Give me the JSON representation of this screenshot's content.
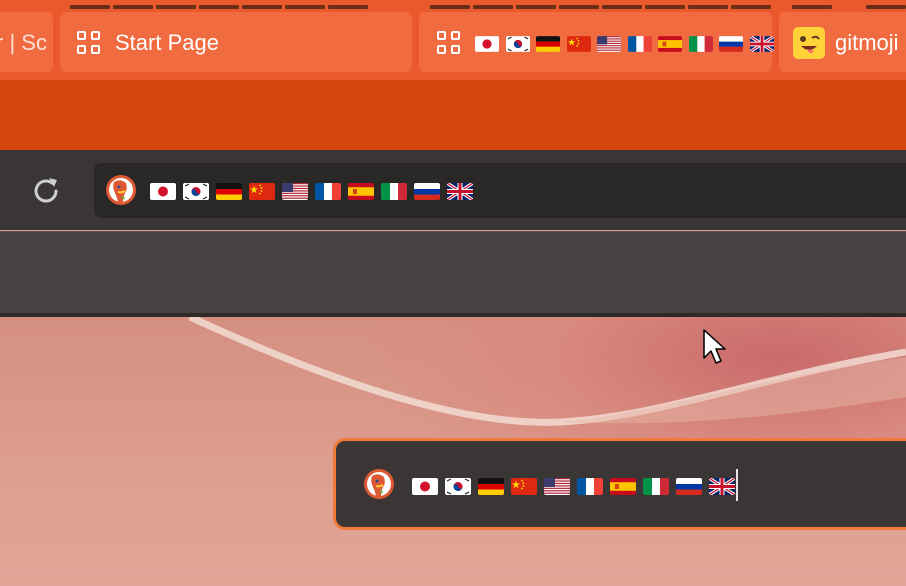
{
  "tabs": [
    {
      "label": "r | Sc"
    },
    {
      "label": "Start Page",
      "icon": "grid-icon"
    },
    {
      "label": "",
      "icon": "grid-icon",
      "flags": [
        "jp",
        "kr",
        "de",
        "cn",
        "us",
        "fr",
        "es",
        "it",
        "ru",
        "gb"
      ]
    },
    {
      "label": "gitmoji",
      "icon": "gitmoji-emoji-icon"
    }
  ],
  "addressbar": {
    "search_engine_icon": "duckduckgo-icon",
    "text_flags": [
      "jp",
      "kr",
      "de",
      "cn",
      "us",
      "fr",
      "es",
      "it",
      "ru",
      "gb"
    ]
  },
  "popup": {
    "search_engine_icon": "duckduckgo-icon",
    "text_flags": [
      "jp",
      "kr",
      "de",
      "cn",
      "us",
      "fr",
      "es",
      "it",
      "ru",
      "gb"
    ]
  },
  "colors": {
    "tabstrip": "#e9592c",
    "accent_band": "#d4450c",
    "toolbar": "#3a3635",
    "popup_border": "#f07a3a"
  }
}
